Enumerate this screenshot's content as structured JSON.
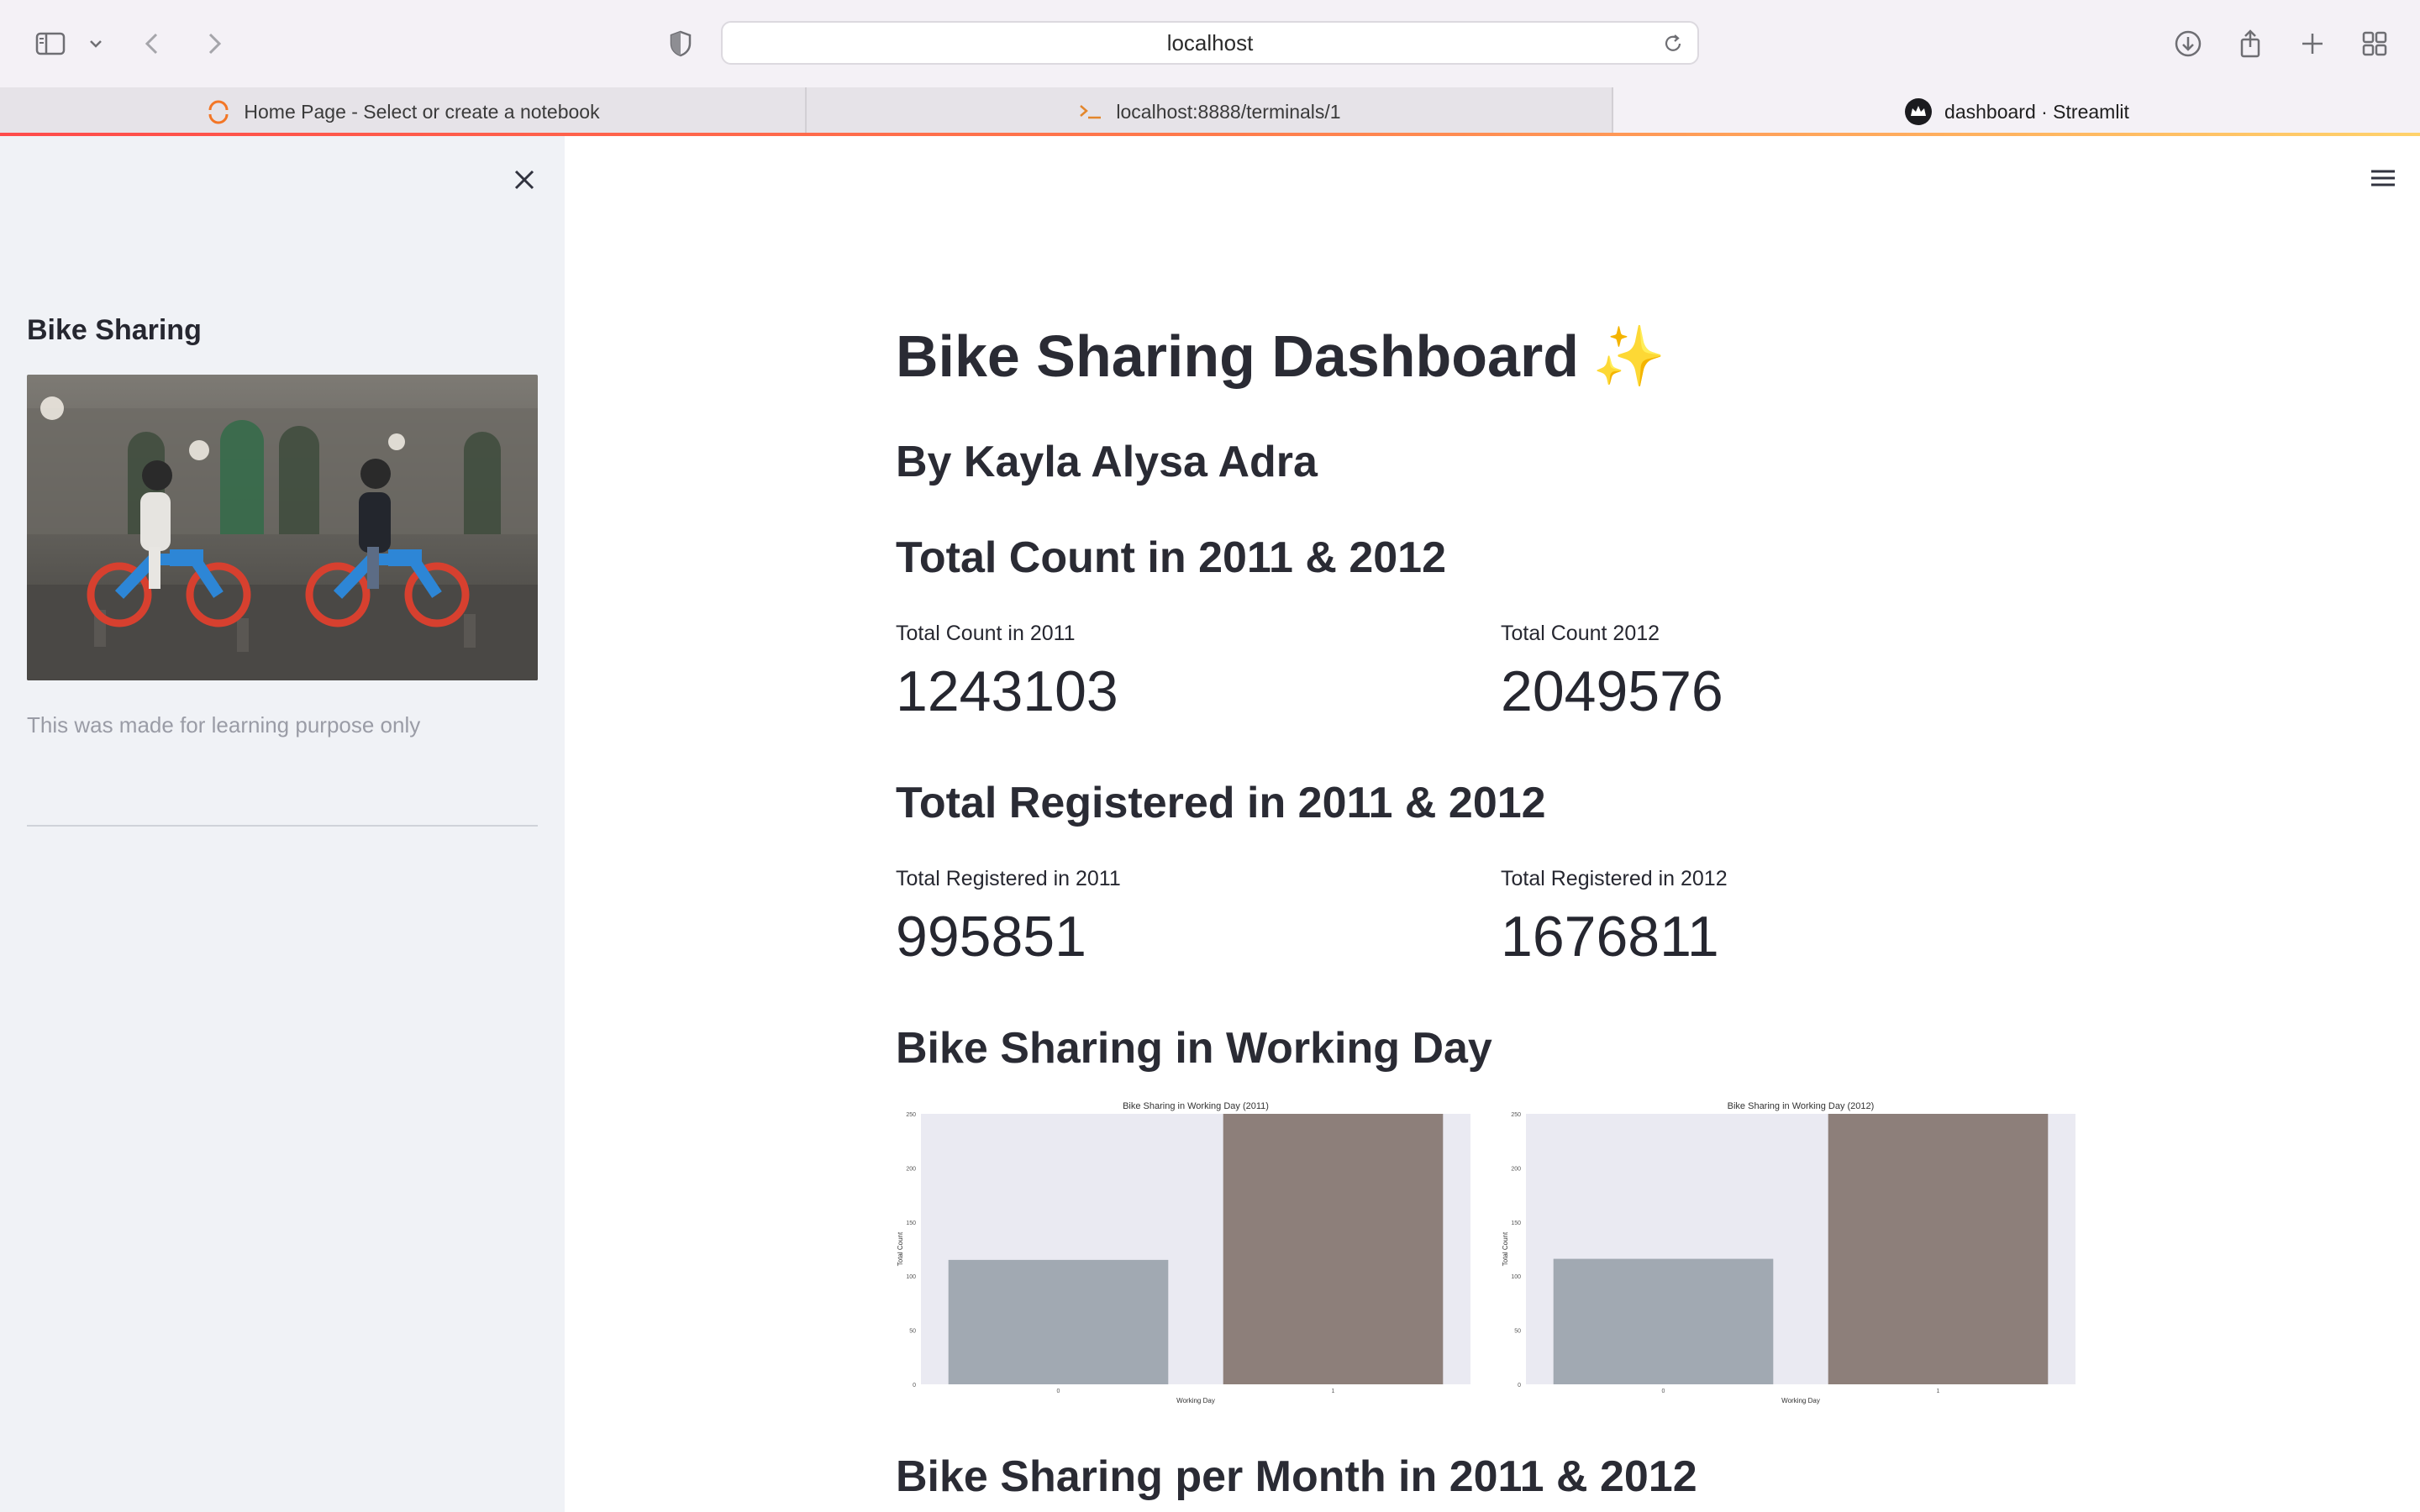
{
  "browser": {
    "url": "localhost",
    "tabs": [
      {
        "title": "Home Page - Select or create a notebook",
        "icon": "jupyter-loading-icon"
      },
      {
        "title": "localhost:8888/terminals/1",
        "icon": "terminal-icon"
      },
      {
        "title": "dashboard · Streamlit",
        "icon": "streamlit-crown-icon",
        "active": true
      }
    ],
    "colors": {
      "accent_gradient": [
        "#ff4b4b",
        "#ffd26b"
      ],
      "toolbar_bg": "#f4f1f6"
    }
  },
  "sidebar": {
    "title": "Bike Sharing",
    "image_alt": "photo-two-people-riding-blue-e-bikes",
    "caption": "This was made for learning purpose only",
    "bg_color": "#f0f2f6"
  },
  "main": {
    "title": "Bike Sharing Dashboard",
    "title_emoji": "✨",
    "subtitle": "By Kayla Alysa Adra",
    "sections": {
      "count_header": "Total Count in 2011 & 2012",
      "registered_header": "Total Registered in 2011 & 2012",
      "working_day_header": "Bike Sharing in Working Day",
      "month_header": "Bike Sharing per Month in 2011 & 2012"
    },
    "metrics": {
      "count_2011_label": "Total Count in 2011",
      "count_2011_value": "1243103",
      "count_2012_label": "Total Count 2012",
      "count_2012_value": "2049576",
      "registered_2011_label": "Total Registered in 2011",
      "registered_2011_value": "995851",
      "registered_2012_label": "Total Registered in 2012",
      "registered_2012_value": "1676811"
    }
  },
  "chart_data": [
    {
      "type": "bar",
      "title": "Bike Sharing in Working Day (2011)",
      "xlabel": "Working Day",
      "ylabel": "Total Count",
      "categories": [
        "0",
        "1"
      ],
      "values": [
        115,
        250
      ],
      "ylim": [
        0,
        250
      ],
      "yticks": [
        0,
        50,
        100,
        150,
        200,
        250
      ],
      "colors": [
        "#a1a9b2",
        "#8d7f7a"
      ],
      "grid": false,
      "background": "#eaeaf2"
    },
    {
      "type": "bar",
      "title": "Bike Sharing in Working Day (2012)",
      "xlabel": "Working Day",
      "ylabel": "Total Count",
      "categories": [
        "0",
        "1"
      ],
      "values": [
        116,
        250
      ],
      "ylim": [
        0,
        250
      ],
      "yticks": [
        0,
        50,
        100,
        150,
        200,
        250
      ],
      "colors": [
        "#a1a9b2",
        "#8d7f7a"
      ],
      "grid": false,
      "background": "#eaeaf2"
    }
  ]
}
